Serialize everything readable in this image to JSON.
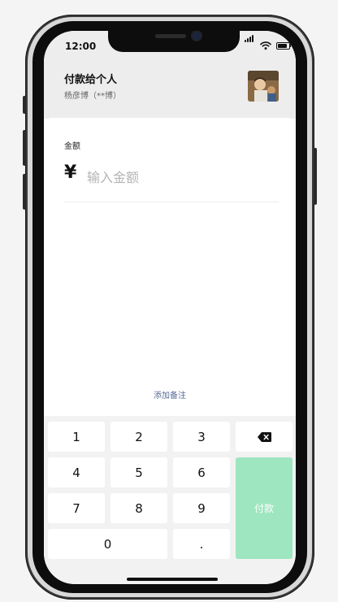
{
  "status_bar": {
    "time": "12:00"
  },
  "header": {
    "title": "付款给个人",
    "payee": "杨彦博（**博）"
  },
  "amount": {
    "label": "金额",
    "currency_symbol": "¥",
    "placeholder": "输入金额",
    "value": ""
  },
  "remark_link": "添加备注",
  "keypad": {
    "keys": [
      "1",
      "2",
      "3",
      "4",
      "5",
      "6",
      "7",
      "8",
      "9",
      "0",
      "."
    ],
    "pay_label": "付款",
    "backspace_icon": "backspace-icon"
  },
  "colors": {
    "pay_button": "#9de6bf",
    "remark_link": "#576b95",
    "header_bg": "#ededed"
  }
}
